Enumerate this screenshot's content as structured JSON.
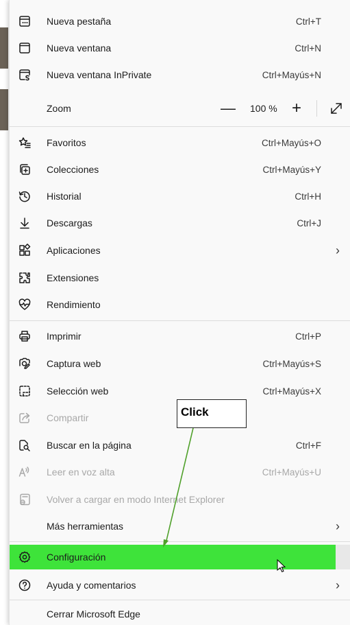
{
  "menu": {
    "new_tab": {
      "label": "Nueva pestaña",
      "shortcut": "Ctrl+T"
    },
    "new_window": {
      "label": "Nueva ventana",
      "shortcut": "Ctrl+N"
    },
    "inprivate": {
      "label": "Nueva ventana InPrivate",
      "shortcut": "Ctrl+Mayús+N"
    },
    "zoom": {
      "label": "Zoom",
      "value": "100 %",
      "minus": "—",
      "plus": "+"
    },
    "favorites": {
      "label": "Favoritos",
      "shortcut": "Ctrl+Mayús+O"
    },
    "collections": {
      "label": "Colecciones",
      "shortcut": "Ctrl+Mayús+Y"
    },
    "history": {
      "label": "Historial",
      "shortcut": "Ctrl+H"
    },
    "downloads": {
      "label": "Descargas",
      "shortcut": "Ctrl+J"
    },
    "apps": {
      "label": "Aplicaciones",
      "chevron": "›"
    },
    "extensions": {
      "label": "Extensiones"
    },
    "performance": {
      "label": "Rendimiento"
    },
    "print": {
      "label": "Imprimir",
      "shortcut": "Ctrl+P"
    },
    "web_capture": {
      "label": "Captura web",
      "shortcut": "Ctrl+Mayús+S"
    },
    "web_select": {
      "label": "Selección web",
      "shortcut": "Ctrl+Mayús+X"
    },
    "share": {
      "label": "Compartir"
    },
    "find": {
      "label": "Buscar en la página",
      "shortcut": "Ctrl+F"
    },
    "read_aloud": {
      "label": "Leer en voz alta",
      "shortcut": "Ctrl+Mayús+U"
    },
    "ie_mode": {
      "label": "Volver a cargar en modo Internet Explorer"
    },
    "more_tools": {
      "label": "Más herramientas",
      "chevron": "›"
    },
    "settings": {
      "label": "Configuración"
    },
    "help": {
      "label": "Ayuda y comentarios",
      "chevron": "›"
    },
    "close": {
      "label": "Cerrar Microsoft Edge"
    }
  },
  "annotation": {
    "text": "Click"
  },
  "colors": {
    "highlight": "#3ee33a",
    "arrow": "#4fa02a"
  },
  "icons": [
    "new-tab-icon",
    "new-window-icon",
    "inprivate-icon",
    "favorites-icon",
    "collections-icon",
    "history-icon",
    "downloads-icon",
    "apps-icon",
    "extensions-icon",
    "performance-icon",
    "print-icon",
    "web-capture-icon",
    "web-select-icon",
    "share-icon",
    "find-icon",
    "read-aloud-icon",
    "ie-mode-icon",
    "settings-icon",
    "help-icon",
    "fullscreen-icon"
  ]
}
